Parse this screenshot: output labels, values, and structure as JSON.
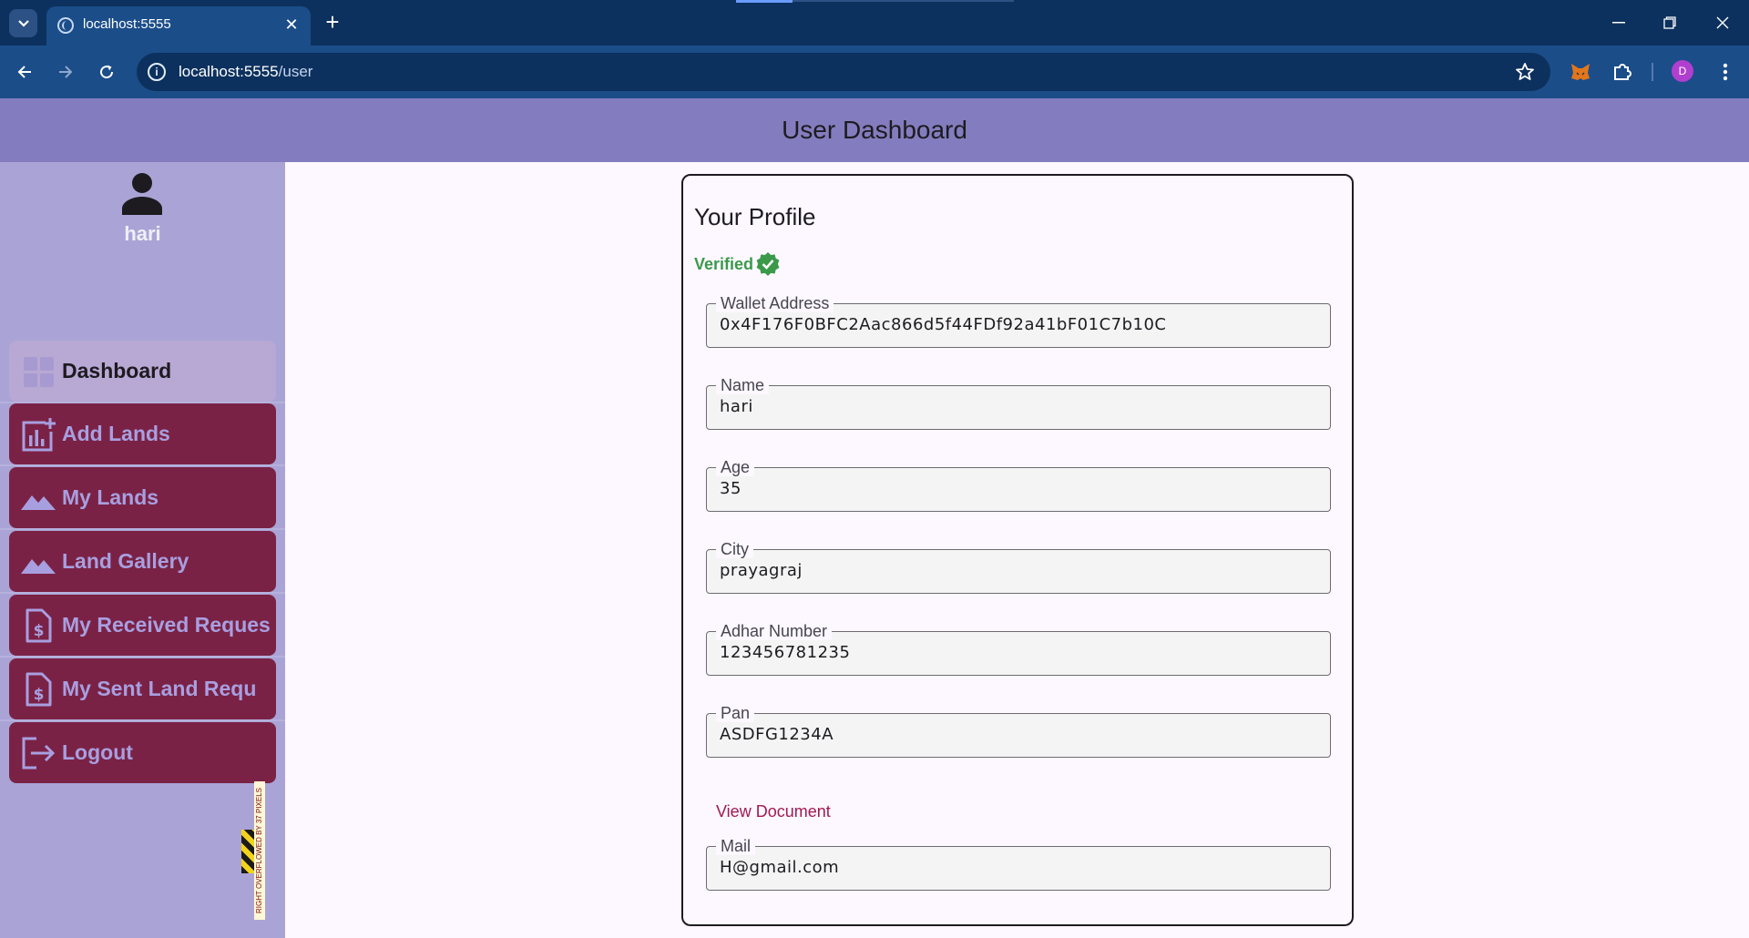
{
  "browser": {
    "tab_title": "localhost:5555",
    "url_host": "localhost:5555",
    "url_path": "/user",
    "profile_initial": "D"
  },
  "app": {
    "title": "User Dashboard"
  },
  "sidebar": {
    "user_name": "hari",
    "items": [
      {
        "label": "Dashboard",
        "icon": "dashboard-grid-icon",
        "active": true
      },
      {
        "label": "Add Lands",
        "icon": "add-chart-icon",
        "active": false
      },
      {
        "label": "My Lands",
        "icon": "landscape-icon",
        "active": false
      },
      {
        "label": "Land Gallery",
        "icon": "landscape-icon",
        "active": false
      },
      {
        "label": "My Received Reques",
        "icon": "request-quote-icon",
        "active": false
      },
      {
        "label": "My Sent Land Requ",
        "icon": "request-quote-icon",
        "active": false
      },
      {
        "label": "Logout",
        "icon": "logout-icon",
        "active": false
      }
    ],
    "overflow_warning": "RIGHT OVERFLOWED BY 37 PIXELS"
  },
  "profile": {
    "title": "Your Profile",
    "status": "Verified",
    "fields": [
      {
        "label": "Wallet Address",
        "value": "0x4F176F0BFC2Aac866d5f44FDf92a41bF01C7b10C"
      },
      {
        "label": "Name",
        "value": "hari"
      },
      {
        "label": "Age",
        "value": "35"
      },
      {
        "label": "City",
        "value": "prayagraj"
      },
      {
        "label": "Adhar Number",
        "value": "123456781235"
      },
      {
        "label": "Pan",
        "value": "ASDFG1234A"
      },
      {
        "label": "Mail",
        "value": "H@gmail.com"
      }
    ],
    "view_document_label": "View Document"
  },
  "colors": {
    "app_bar": "#837dbf",
    "sidebar": "#aaa4d6",
    "nav_item": "#7a2245",
    "nav_active": "#b8a8d4",
    "verified": "#3a9a4a",
    "link": "#a01a52"
  }
}
